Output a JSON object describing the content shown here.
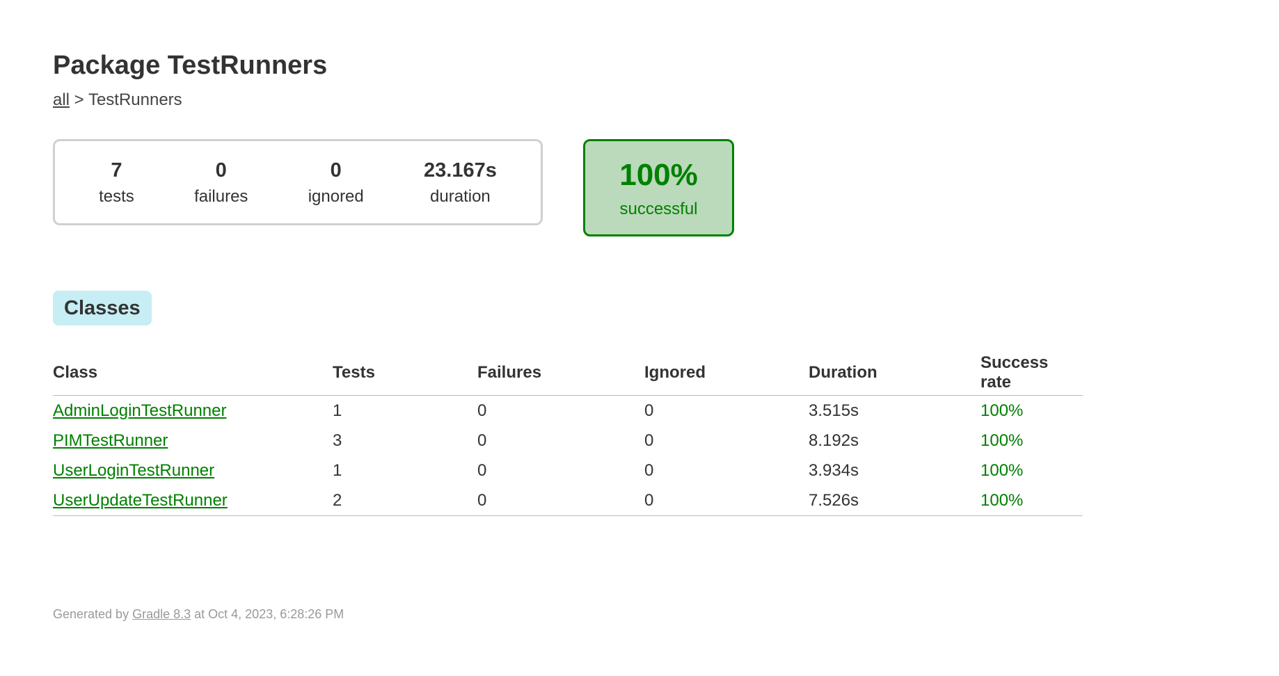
{
  "page": {
    "title": "Package TestRunners"
  },
  "breadcrumb": {
    "link": "all",
    "separator": " > ",
    "current": "TestRunners"
  },
  "summary": {
    "tests": {
      "value": "7",
      "label": "tests"
    },
    "failures": {
      "value": "0",
      "label": "failures"
    },
    "ignored": {
      "value": "0",
      "label": "ignored"
    },
    "duration": {
      "value": "23.167s",
      "label": "duration"
    },
    "success": {
      "value": "100%",
      "label": "successful",
      "color": "#008000"
    }
  },
  "tabs": [
    {
      "label": "Classes"
    }
  ],
  "table": {
    "headers": [
      "Class",
      "Tests",
      "Failures",
      "Ignored",
      "Duration",
      "Success rate"
    ],
    "rows": [
      {
        "class": "AdminLoginTestRunner",
        "tests": "1",
        "failures": "0",
        "ignored": "0",
        "duration": "3.515s",
        "success": "100%"
      },
      {
        "class": "PIMTestRunner",
        "tests": "3",
        "failures": "0",
        "ignored": "0",
        "duration": "8.192s",
        "success": "100%"
      },
      {
        "class": "UserLoginTestRunner",
        "tests": "1",
        "failures": "0",
        "ignored": "0",
        "duration": "3.934s",
        "success": "100%"
      },
      {
        "class": "UserUpdateTestRunner",
        "tests": "2",
        "failures": "0",
        "ignored": "0",
        "duration": "7.526s",
        "success": "100%"
      }
    ]
  },
  "footer": {
    "prefix": "Generated by ",
    "link": "Gradle 8.3",
    "suffix": " at Oct 4, 2023, 6:28:26 PM"
  }
}
